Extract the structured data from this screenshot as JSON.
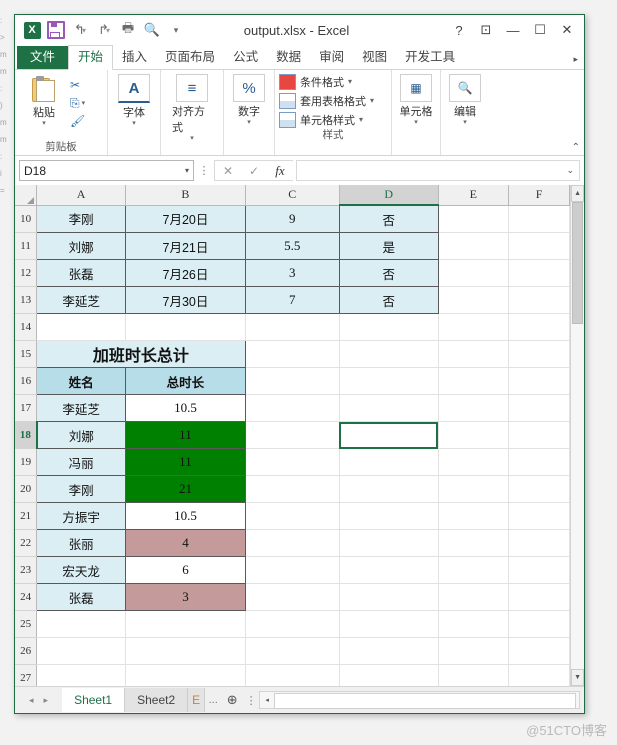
{
  "window": {
    "title": "output.xlsx - Excel",
    "quick_access": [
      {
        "name": "excel-logo",
        "glyph": "X"
      },
      {
        "name": "save",
        "glyph": "save"
      },
      {
        "name": "undo",
        "glyph": "↰"
      },
      {
        "name": "redo",
        "glyph": "↱"
      },
      {
        "name": "quick-print",
        "glyph": "print-check"
      },
      {
        "name": "print-preview",
        "glyph": "preview"
      },
      {
        "name": "customize",
        "glyph": "▾"
      }
    ],
    "controls": [
      {
        "name": "help",
        "glyph": "?"
      },
      {
        "name": "ribbon-display-options",
        "glyph": "⊡"
      },
      {
        "name": "minimize",
        "glyph": "—"
      },
      {
        "name": "maximize",
        "glyph": "☐"
      },
      {
        "name": "close",
        "glyph": "✕"
      }
    ]
  },
  "ribbon": {
    "tabs": [
      {
        "label": "文件",
        "kind": "file"
      },
      {
        "label": "开始",
        "kind": "active"
      },
      {
        "label": "插入",
        "kind": "normal"
      },
      {
        "label": "页面布局",
        "kind": "normal"
      },
      {
        "label": "公式",
        "kind": "normal"
      },
      {
        "label": "数据",
        "kind": "normal"
      },
      {
        "label": "审阅",
        "kind": "normal"
      },
      {
        "label": "视图",
        "kind": "normal"
      },
      {
        "label": "开发工具",
        "kind": "normal"
      }
    ],
    "more_tabs": "▸",
    "groups": {
      "clipboard": {
        "name": "剪贴板",
        "paste": "粘贴",
        "cut": "✂",
        "copy": "⎘",
        "format_painter": "🖌",
        "dropdown": "▾"
      },
      "font": {
        "label": "字体",
        "glyph": "A",
        "dropdown": "▾"
      },
      "align": {
        "label": "对齐方式",
        "glyph": "≡",
        "dropdown": "▾"
      },
      "number": {
        "label": "数字",
        "glyph": "%",
        "dropdown": "▾"
      },
      "styles": {
        "name": "样式",
        "items": [
          {
            "label": "条件格式",
            "arrow": "▾"
          },
          {
            "label": "套用表格格式",
            "arrow": "▾"
          },
          {
            "label": "单元格样式",
            "arrow": "▾"
          }
        ]
      },
      "cells": {
        "label": "单元格",
        "dropdown": "▾"
      },
      "editing": {
        "label": "编辑",
        "glyph": "🔍",
        "dropdown": "▾"
      },
      "collapse": "⌃"
    }
  },
  "formula_bar": {
    "name_box_value": "D18",
    "name_box_caret": "▾",
    "cancel": "✕",
    "enter": "✓",
    "fx": "fx",
    "formula_value": "",
    "expand": "⌄",
    "menu_dots": "⋮"
  },
  "sheet": {
    "columns": [
      {
        "label": "A",
        "width": 94,
        "selected": false
      },
      {
        "label": "B",
        "width": 128,
        "selected": false
      },
      {
        "label": "C",
        "width": 104,
        "selected": false
      },
      {
        "label": "D",
        "width": 110,
        "selected": true
      },
      {
        "label": "E",
        "width": 78,
        "selected": false
      },
      {
        "label": "F",
        "width": 68,
        "selected": false
      }
    ],
    "active_cell": "D18",
    "rows": [
      {
        "num": "10",
        "selected": false,
        "cells": [
          {
            "v": "李刚",
            "style": "blue box"
          },
          {
            "v": "7月20日",
            "style": "blue box"
          },
          {
            "v": "9",
            "style": "blue box num"
          },
          {
            "v": "否",
            "style": "blue box"
          },
          {
            "v": "",
            "style": ""
          },
          {
            "v": "",
            "style": ""
          }
        ]
      },
      {
        "num": "11",
        "selected": false,
        "cells": [
          {
            "v": "刘娜",
            "style": "blue box"
          },
          {
            "v": "7月21日",
            "style": "blue box"
          },
          {
            "v": "5.5",
            "style": "blue box num"
          },
          {
            "v": "是",
            "style": "blue box"
          },
          {
            "v": "",
            "style": ""
          },
          {
            "v": "",
            "style": ""
          }
        ]
      },
      {
        "num": "12",
        "selected": false,
        "cells": [
          {
            "v": "张磊",
            "style": "blue box"
          },
          {
            "v": "7月26日",
            "style": "blue box"
          },
          {
            "v": "3",
            "style": "blue box num"
          },
          {
            "v": "否",
            "style": "blue box"
          },
          {
            "v": "",
            "style": ""
          },
          {
            "v": "",
            "style": ""
          }
        ]
      },
      {
        "num": "13",
        "selected": false,
        "cells": [
          {
            "v": "李延芝",
            "style": "blue box"
          },
          {
            "v": "7月30日",
            "style": "blue box"
          },
          {
            "v": "7",
            "style": "blue box num"
          },
          {
            "v": "否",
            "style": "blue box"
          },
          {
            "v": "",
            "style": ""
          },
          {
            "v": "",
            "style": ""
          }
        ]
      },
      {
        "num": "14",
        "selected": false,
        "cells": [
          {
            "v": "",
            "style": ""
          },
          {
            "v": "",
            "style": ""
          },
          {
            "v": "",
            "style": ""
          },
          {
            "v": "",
            "style": ""
          },
          {
            "v": "",
            "style": ""
          },
          {
            "v": "",
            "style": ""
          }
        ]
      },
      {
        "num": "15",
        "selected": false,
        "merged_title": "加班时长总计"
      },
      {
        "num": "16",
        "selected": false,
        "cells": [
          {
            "v": "姓名",
            "style": "hdr box"
          },
          {
            "v": "总时长",
            "style": "hdr box"
          },
          {
            "v": "",
            "style": ""
          },
          {
            "v": "",
            "style": ""
          },
          {
            "v": "",
            "style": ""
          },
          {
            "v": "",
            "style": ""
          }
        ]
      },
      {
        "num": "17",
        "selected": false,
        "cells": [
          {
            "v": "李延芝",
            "style": "blue box"
          },
          {
            "v": "10.5",
            "style": "white box num"
          },
          {
            "v": "",
            "style": ""
          },
          {
            "v": "",
            "style": ""
          },
          {
            "v": "",
            "style": ""
          },
          {
            "v": "",
            "style": ""
          }
        ]
      },
      {
        "num": "18",
        "selected": true,
        "cells": [
          {
            "v": "刘娜",
            "style": "blue box"
          },
          {
            "v": "11",
            "style": "green box num"
          },
          {
            "v": "",
            "style": ""
          },
          {
            "v": "",
            "style": "active"
          },
          {
            "v": "",
            "style": ""
          },
          {
            "v": "",
            "style": ""
          }
        ]
      },
      {
        "num": "19",
        "selected": false,
        "cells": [
          {
            "v": "冯丽",
            "style": "blue box"
          },
          {
            "v": "11",
            "style": "green box num"
          },
          {
            "v": "",
            "style": ""
          },
          {
            "v": "",
            "style": ""
          },
          {
            "v": "",
            "style": ""
          },
          {
            "v": "",
            "style": ""
          }
        ]
      },
      {
        "num": "20",
        "selected": false,
        "cells": [
          {
            "v": "李刚",
            "style": "blue box"
          },
          {
            "v": "21",
            "style": "green box num"
          },
          {
            "v": "",
            "style": ""
          },
          {
            "v": "",
            "style": ""
          },
          {
            "v": "",
            "style": ""
          },
          {
            "v": "",
            "style": ""
          }
        ]
      },
      {
        "num": "21",
        "selected": false,
        "cells": [
          {
            "v": "方振宇",
            "style": "blue box"
          },
          {
            "v": "10.5",
            "style": "white box num"
          },
          {
            "v": "",
            "style": ""
          },
          {
            "v": "",
            "style": ""
          },
          {
            "v": "",
            "style": ""
          },
          {
            "v": "",
            "style": ""
          }
        ]
      },
      {
        "num": "22",
        "selected": false,
        "cells": [
          {
            "v": "张丽",
            "style": "blue box"
          },
          {
            "v": "4",
            "style": "rose box num"
          },
          {
            "v": "",
            "style": ""
          },
          {
            "v": "",
            "style": ""
          },
          {
            "v": "",
            "style": ""
          },
          {
            "v": "",
            "style": ""
          }
        ]
      },
      {
        "num": "23",
        "selected": false,
        "cells": [
          {
            "v": "宏天龙",
            "style": "blue box"
          },
          {
            "v": "6",
            "style": "white box num"
          },
          {
            "v": "",
            "style": ""
          },
          {
            "v": "",
            "style": ""
          },
          {
            "v": "",
            "style": ""
          },
          {
            "v": "",
            "style": ""
          }
        ]
      },
      {
        "num": "24",
        "selected": false,
        "cells": [
          {
            "v": "张磊",
            "style": "blue box"
          },
          {
            "v": "3",
            "style": "rose box num"
          },
          {
            "v": "",
            "style": ""
          },
          {
            "v": "",
            "style": ""
          },
          {
            "v": "",
            "style": ""
          },
          {
            "v": "",
            "style": ""
          }
        ]
      },
      {
        "num": "25",
        "selected": false,
        "cells": [
          {
            "v": "",
            "style": ""
          },
          {
            "v": "",
            "style": ""
          },
          {
            "v": "",
            "style": ""
          },
          {
            "v": "",
            "style": ""
          },
          {
            "v": "",
            "style": ""
          },
          {
            "v": "",
            "style": ""
          }
        ]
      },
      {
        "num": "26",
        "selected": false,
        "cells": [
          {
            "v": "",
            "style": ""
          },
          {
            "v": "",
            "style": ""
          },
          {
            "v": "",
            "style": ""
          },
          {
            "v": "",
            "style": ""
          },
          {
            "v": "",
            "style": ""
          },
          {
            "v": "",
            "style": ""
          }
        ]
      },
      {
        "num": "27",
        "selected": false,
        "cells": [
          {
            "v": "",
            "style": ""
          },
          {
            "v": "",
            "style": ""
          },
          {
            "v": "",
            "style": ""
          },
          {
            "v": "",
            "style": ""
          },
          {
            "v": "",
            "style": ""
          },
          {
            "v": "",
            "style": ""
          }
        ]
      },
      {
        "num": "28",
        "selected": false,
        "cells": [
          {
            "v": "",
            "style": ""
          },
          {
            "v": "",
            "style": ""
          },
          {
            "v": "",
            "style": ""
          },
          {
            "v": "",
            "style": ""
          },
          {
            "v": "",
            "style": ""
          },
          {
            "v": "",
            "style": ""
          }
        ]
      }
    ]
  },
  "sheet_tabs": {
    "prev": "◂",
    "next": "▸",
    "tabs": [
      {
        "label": "Sheet1",
        "state": "active"
      },
      {
        "label": "Sheet2",
        "state": "normal"
      },
      {
        "label": "E",
        "state": "truncated"
      }
    ],
    "ellipsis": "...",
    "add": "⊕",
    "dots": "⋮",
    "hs_left": "◂",
    "hs_right": "▸"
  },
  "colors": {
    "accent_green": "#1e7145",
    "cell_green": "#008000",
    "cell_rose": "#c49a9a",
    "cell_blue": "#daeef3",
    "header_blue": "#b7dde8"
  },
  "watermark": "@51CTO博客"
}
